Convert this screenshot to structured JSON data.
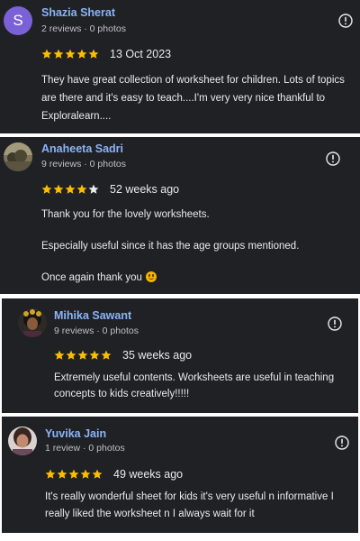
{
  "reviews": [
    {
      "name": "Shazia Sherat",
      "avatar_letter": "S",
      "meta": "2 reviews · 0 photos",
      "rating": 5,
      "date": "13 Oct 2023",
      "text": "They have great collection of worksheet for children. Lots of topics are there and it's easy to teach....I'm very very nice thankful to Exploralearn...."
    },
    {
      "name": "Anaheeta Sadri",
      "meta": "9 reviews · 0 photos",
      "rating": 4,
      "date": "52 weeks ago",
      "paragraphs": [
        "Thank you for the lovely worksheets.",
        "Especially useful since it has the age groups mentioned.",
        "Once again thank you"
      ]
    },
    {
      "name": "Mihika Sawant",
      "meta": "9 reviews · 0 photos",
      "rating": 5,
      "date": "35 weeks ago",
      "text": "Extremely useful contents. Worksheets are useful in teaching concepts to kids creatively!!!!!"
    },
    {
      "name": "Yuvika Jain",
      "meta": "1 review · 0 photos",
      "rating": 5,
      "date": "49 weeks ago",
      "text": "It's really wonderful sheet for kids it's very useful n informative I really liked the worksheet n I always wait for it"
    }
  ],
  "colors": {
    "card_background": "#202124",
    "name_link": "#8ab4f8",
    "star_filled": "#fbbc04",
    "star_empty": "#e8eaed",
    "avatar_letter_bg": "#7b61d6"
  },
  "icons": {
    "report": "info-circle-icon",
    "emoji": "smiling-face-icon"
  }
}
